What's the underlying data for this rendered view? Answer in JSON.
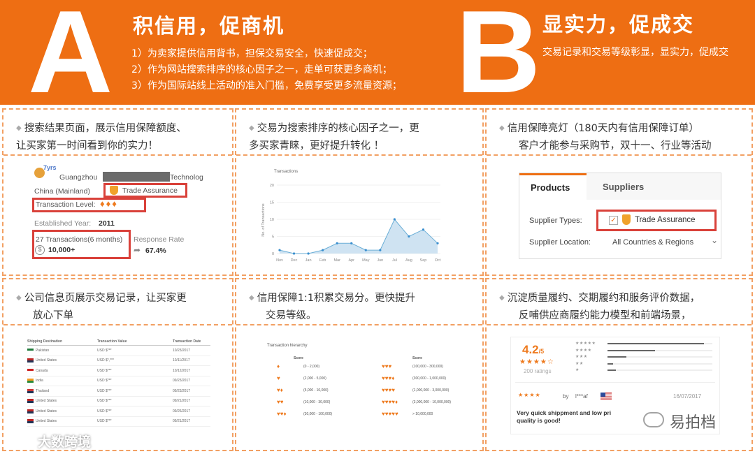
{
  "header": {
    "a": {
      "letter": "A",
      "title": "积信用，促商机",
      "lines": [
        "1）为卖家提供信用背书，担保交易安全，快速促成交；",
        "2）作为网站搜索排序的核心因子之一，走单可获更多商机；",
        "3）作为国际站线上活动的准入门槛，免费享受更多流量资源；"
      ]
    },
    "b": {
      "letter": "B",
      "title": "显实力，促成交",
      "line": "交易记录和交易等级彰显，显实力，促成交"
    }
  },
  "cards": {
    "c1": {
      "text": [
        "搜索结果页面，展示信用保障额度、",
        "让买家第一时间看到你的实力！"
      ],
      "years": "7yrs",
      "company_prefix": "Guangzhou",
      "company_suffix": "Technolog",
      "country": "China (Mainland)",
      "trade_assurance": "Trade Assurance",
      "level_label": "Transaction Level:",
      "established": "Established Year:",
      "established_value": "2011",
      "transactions": "27 Transactions(6 months)",
      "amount": "10,000+",
      "response_label": "Response Rate",
      "response_value": "67.4%"
    },
    "c2": {
      "text": [
        "交易为搜索排序的核心因子之一，更",
        "多买家青睐，更好提升转化 ！"
      ],
      "chart_title": "Transactions",
      "ylabel": "No. of Transactions"
    },
    "c3": {
      "text": [
        "信用保障亮灯（180天内有信用保障订单）",
        "客户才能参与采购节，双十一、行业等活动"
      ],
      "tab_products": "Products",
      "tab_suppliers": "Suppliers",
      "supplier_types": "Supplier Types:",
      "trade_assurance": "Trade Assurance",
      "supplier_location": "Supplier Location:",
      "location_value": "All Countries & Regions"
    },
    "c4": {
      "text": [
        "公司信息页展示交易记录，让买家更",
        "放心下单"
      ],
      "col1": "Shipping Destination",
      "col2": "Transaction Value",
      "col3": "Transaction Date",
      "rows": [
        [
          "Pakistan",
          "USD $***",
          "10/23/2017"
        ],
        [
          "United States",
          "USD $*,***",
          "10/11/2017"
        ],
        [
          "Canada",
          "USD $***",
          "10/12/2017"
        ],
        [
          "India",
          "USD $***",
          "09/23/2017"
        ],
        [
          "Thailand",
          "USD $***",
          "09/23/2017"
        ],
        [
          "United States",
          "USD $***",
          "09/21/2017"
        ],
        [
          "United States",
          "USD $***",
          "09/26/2017"
        ],
        [
          "United States",
          "USD $***",
          "09/21/2017"
        ]
      ]
    },
    "c5": {
      "text": [
        "信用保障1:1积累交易分。更快提升",
        "交易等级。"
      ],
      "title": "Transaction hierarchy",
      "score_label": "Score",
      "left": [
        "(0 - 2,000)",
        "(2,000 - 5,000)",
        "(5,000 - 10,000)",
        "(10,000 - 30,000)",
        "(30,000 - 100,000)"
      ],
      "right": [
        "(100,000 - 300,000)",
        "(300,000 - 1,000,000)",
        "(1,000,000 - 3,000,000)",
        "(3,000,000 - 10,000,000)",
        "> 10,000,000"
      ]
    },
    "c6": {
      "text": [
        "沉淀质量履约、交期履约和服务评价数据，",
        "反哺供应商履约能力模型和前端场景，"
      ],
      "rating": "4.2",
      "rating_suffix": "/5",
      "ratings_count": "200 ratings",
      "by": "by",
      "reviewer": "l***af",
      "date": "16/07/2017",
      "review": [
        "Very quick shippment and low pri",
        "quality is good!"
      ]
    }
  },
  "watermarks": {
    "left": "大数跨境",
    "right": "易拍档"
  },
  "chart_data": {
    "type": "line",
    "title": "Transactions",
    "ylabel": "No. of Transactions",
    "categories": [
      "Nov",
      "Dec",
      "Jan",
      "Feb",
      "Mar",
      "Apr",
      "May",
      "Jun",
      "Jul",
      "Aug",
      "Sep",
      "Oct"
    ],
    "values": [
      1,
      0,
      0,
      1,
      3,
      3,
      1,
      1,
      10,
      5,
      7,
      3
    ],
    "ylim": [
      0,
      20
    ],
    "yticks": [
      0,
      5,
      10,
      15,
      20
    ],
    "grid": true,
    "colors": {
      "line": "#6aaed6",
      "fill": "#cfe3f2"
    }
  }
}
